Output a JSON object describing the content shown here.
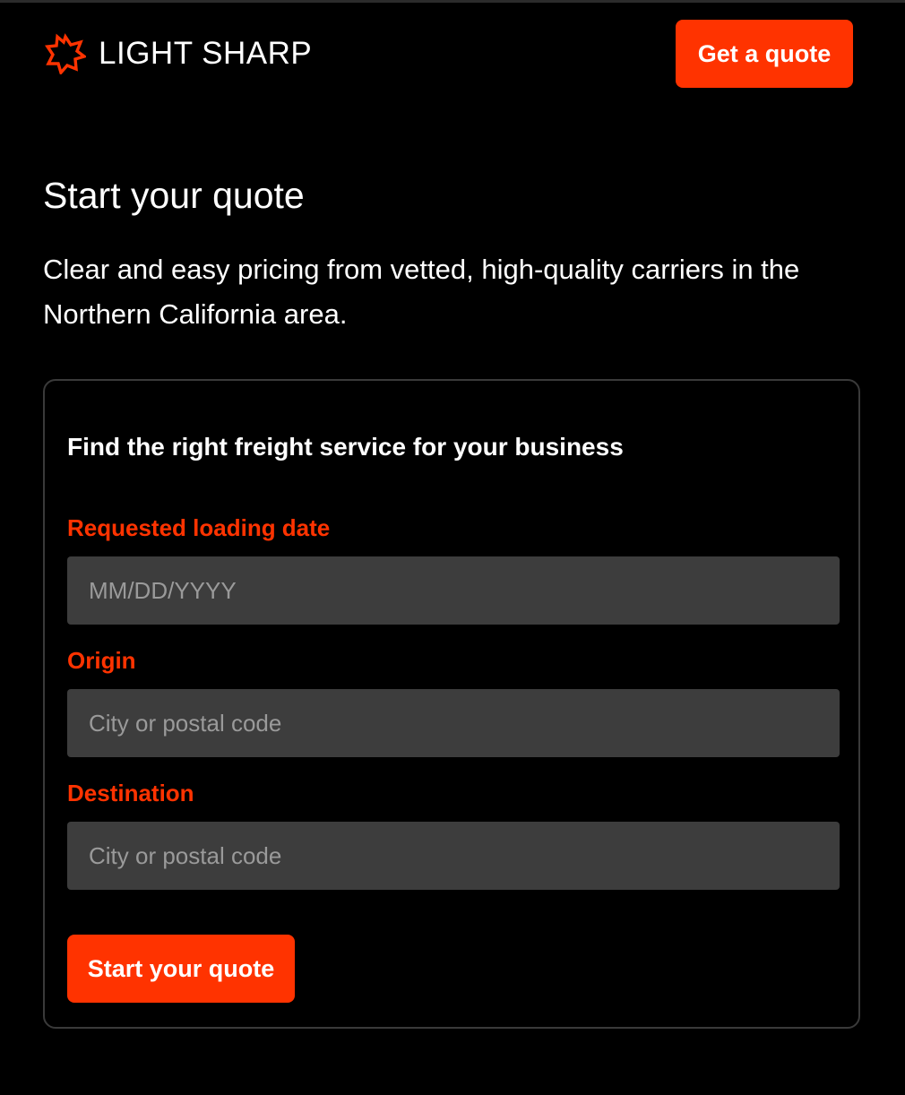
{
  "brand": {
    "name": "LIGHT SHARP",
    "accent_color": "#ff3300"
  },
  "header": {
    "cta_label": "Get a quote"
  },
  "hero": {
    "title": "Start your quote",
    "subtitle": "Clear and easy pricing from vetted, high-quality carriers in the Northern California area."
  },
  "form": {
    "title": "Find the right freight service for your business",
    "fields": [
      {
        "label": "Requested loading date",
        "placeholder": "MM/DD/YYYY",
        "value": ""
      },
      {
        "label": "Origin",
        "placeholder": "City or postal code",
        "value": ""
      },
      {
        "label": "Destination",
        "placeholder": "City or postal code",
        "value": ""
      }
    ],
    "submit_label": "Start your quote"
  },
  "icons": {
    "logo": "starburst-logo-icon"
  }
}
